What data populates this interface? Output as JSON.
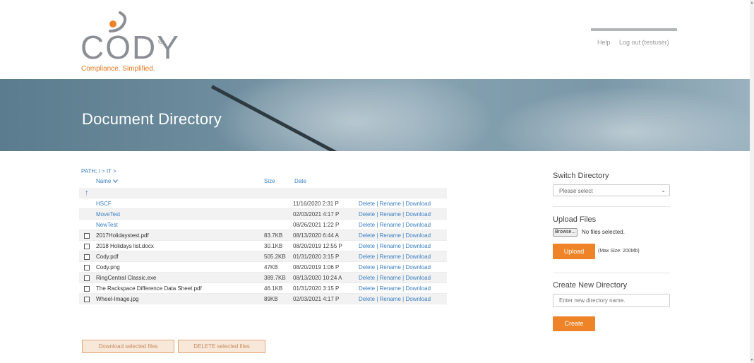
{
  "brand": {
    "name": "CODY",
    "registered": "®",
    "tagline": "Compliance. Simplified.",
    "accent_orange": "#ee8427",
    "link_blue": "#3b7fc4"
  },
  "top_nav": {
    "help": "Help",
    "logout": "Log out (testuser)"
  },
  "banner": {
    "title": "Document Directory"
  },
  "browser": {
    "path": "PATH: / > IT >",
    "columns": {
      "name": "Name",
      "size": "Size",
      "date": "Date"
    },
    "up_icon": "↑",
    "sort_icon": "chevron-down-icon",
    "rows": [
      {
        "name": "HSCF",
        "size": "",
        "date": "11/16/2020 2:31 P",
        "is_dir": true
      },
      {
        "name": "MoveTest",
        "size": "",
        "date": "02/03/2021 4:17 P",
        "is_dir": true
      },
      {
        "name": "NewTest",
        "size": "",
        "date": "08/26/2021 1:22 P",
        "is_dir": true
      },
      {
        "name": "2017Holidaystest.pdf",
        "size": "83.7KB",
        "date": "08/13/2020 6:44 A",
        "is_dir": false
      },
      {
        "name": "2018 Holidays list.docx",
        "size": "30.1KB",
        "date": "08/20/2019 12:55 P",
        "is_dir": false
      },
      {
        "name": "Cody.pdf",
        "size": "505.2KB",
        "date": "01/31/2020 3:15 P",
        "is_dir": false
      },
      {
        "name": "Cody.png",
        "size": "47KB",
        "date": "08/20/2019 1:06 P",
        "is_dir": false
      },
      {
        "name": "RingCentral Classic.exe",
        "size": "389.7KB",
        "date": "08/13/2020 10:24 A",
        "is_dir": false
      },
      {
        "name": "The Rackspace Difference Data Sheet.pdf",
        "size": "46.1KB",
        "date": "01/31/2020 3:15 P",
        "is_dir": false
      },
      {
        "name": "Wheel-Image.jpg",
        "size": "89KB",
        "date": "02/03/2021 4:17 P",
        "is_dir": false
      }
    ],
    "actions": {
      "delete": "Delete",
      "rename": "Rename",
      "download": "Download",
      "separator": " | "
    },
    "download_selected": "Download selected files",
    "delete_selected": "DELETE selected files"
  },
  "sidebar": {
    "switch_title": "Switch Directory",
    "switch_select_value": "Please select",
    "upload_title": "Upload Files",
    "browse_label": "Browse...",
    "no_files": "No files selected.",
    "upload_button": "Upload",
    "max_size": "(Max Size: 200Mb)",
    "create_title": "Create New Directory",
    "create_placeholder": "Enter new directory name.",
    "create_button": "Create"
  }
}
